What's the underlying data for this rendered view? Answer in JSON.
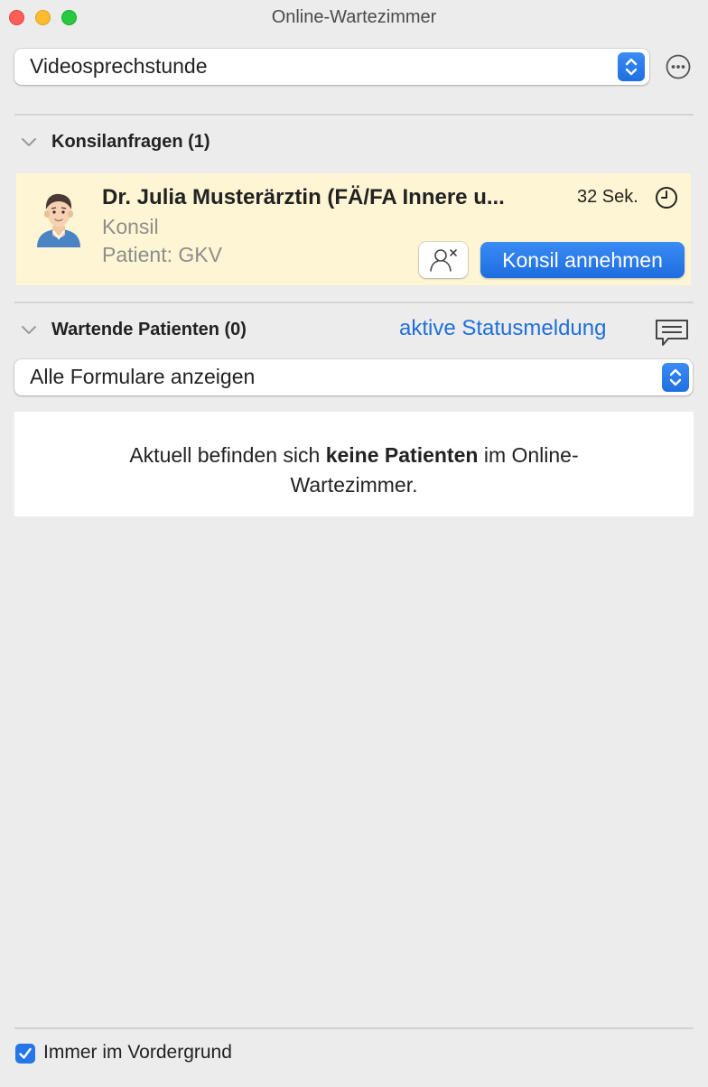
{
  "window": {
    "title": "Online-Wartezimmer"
  },
  "top_select": {
    "value": "Videosprechstunde"
  },
  "consult_section": {
    "title": "Konsilanfragen (1)",
    "request": {
      "doctor_name": "Dr. Julia Musterärztin (FÄ/FA Innere u...",
      "type": "Konsil",
      "patient": "Patient: GKV",
      "wait_time": "32 Sek.",
      "accept_label": "Konsil annehmen"
    }
  },
  "waiting_section": {
    "title": "Wartende Patienten (0)",
    "status_link": "aktive Statusmeldung",
    "form_select": {
      "value": "Alle Formulare anzeigen"
    },
    "empty_message": {
      "before": "Aktuell befinden sich ",
      "bold": "keine Patienten",
      "after": " im Online-",
      "line2": "Wartezimmer."
    }
  },
  "footer": {
    "always_on_top_label": "Immer im Vordergrund",
    "always_on_top_checked": true
  },
  "colors": {
    "accent": "#1f6fdb",
    "card_background": "#fdf5d3",
    "window_background": "#ececec"
  },
  "icons": [
    "more-icon",
    "chevron-down-icon",
    "clock-icon",
    "decline-person-icon",
    "message-icon",
    "checkmark-icon",
    "stepper-icon"
  ]
}
